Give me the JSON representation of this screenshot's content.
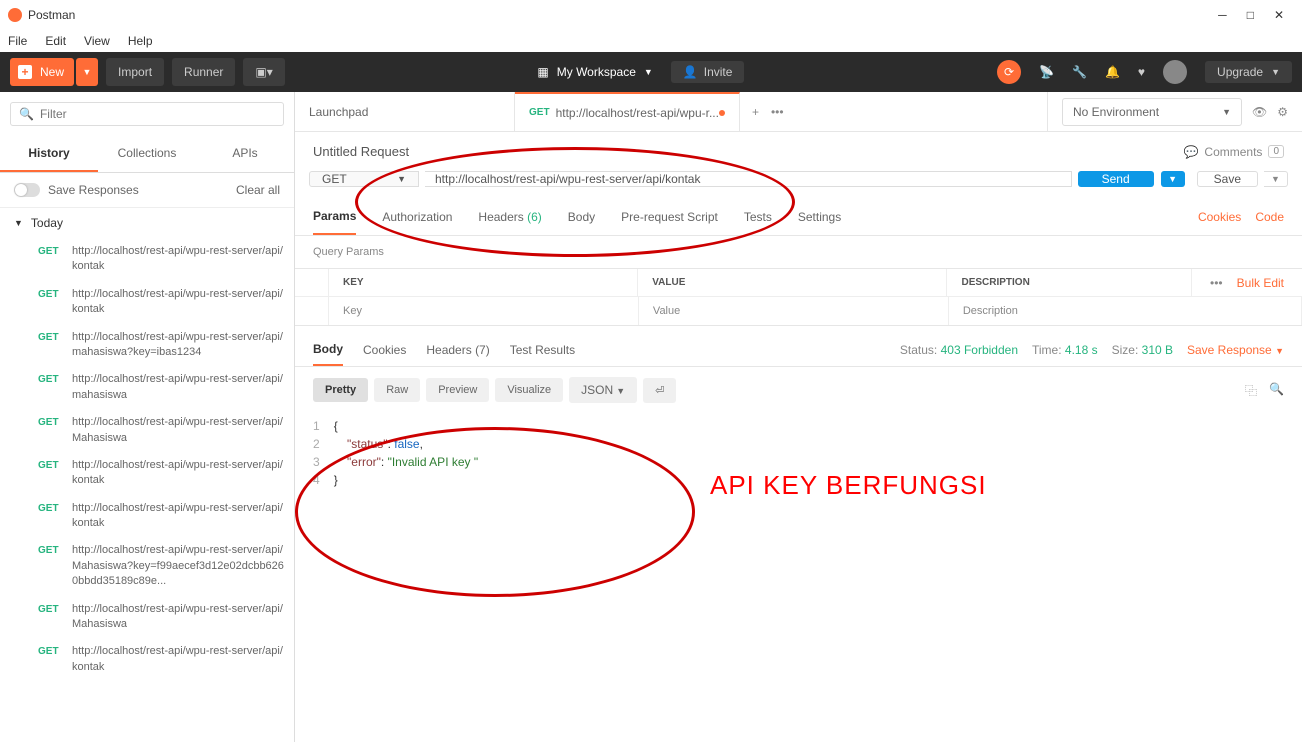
{
  "app": {
    "title": "Postman"
  },
  "menu": {
    "file": "File",
    "edit": "Edit",
    "view": "View",
    "help": "Help"
  },
  "window": {
    "minimize": "─",
    "maximize": "□",
    "close": "✕"
  },
  "toolbar": {
    "new": "New",
    "import": "Import",
    "runner": "Runner",
    "workspace": "My Workspace",
    "invite": "Invite",
    "upgrade": "Upgrade"
  },
  "sidebar": {
    "filter_placeholder": "Filter",
    "tabs": {
      "history": "History",
      "collections": "Collections",
      "apis": "APIs"
    },
    "save_responses": "Save Responses",
    "clear_all": "Clear all",
    "today": "Today",
    "history": [
      {
        "method": "GET",
        "url": "http://localhost/rest-api/wpu-rest-server/api/kontak"
      },
      {
        "method": "GET",
        "url": "http://localhost/rest-api/wpu-rest-server/api/kontak"
      },
      {
        "method": "GET",
        "url": "http://localhost/rest-api/wpu-rest-server/api/mahasiswa?key=ibas1234"
      },
      {
        "method": "GET",
        "url": "http://localhost/rest-api/wpu-rest-server/api/mahasiswa"
      },
      {
        "method": "GET",
        "url": "http://localhost/rest-api/wpu-rest-server/api/Mahasiswa"
      },
      {
        "method": "GET",
        "url": "http://localhost/rest-api/wpu-rest-server/api/kontak"
      },
      {
        "method": "GET",
        "url": "http://localhost/rest-api/wpu-rest-server/api/kontak"
      },
      {
        "method": "GET",
        "url": "http://localhost/rest-api/wpu-rest-server/api/Mahasiswa?key=f99aecef3d12e02dcbb6260bbdd35189c89e..."
      },
      {
        "method": "GET",
        "url": "http://localhost/rest-api/wpu-rest-server/api/Mahasiswa"
      },
      {
        "method": "GET",
        "url": "http://localhost/rest-api/wpu-rest-server/api/kontak"
      }
    ]
  },
  "tabs": {
    "t1": "Launchpad",
    "t2_method": "GET",
    "t2_url": "http://localhost/rest-api/wpu-r..."
  },
  "env": {
    "none": "No Environment"
  },
  "request": {
    "name": "Untitled Request",
    "comments": "Comments",
    "comments_count": "0",
    "method": "GET",
    "url": "http://localhost/rest-api/wpu-rest-server/api/kontak",
    "send": "Send",
    "save": "Save",
    "tabs": {
      "params": "Params",
      "auth": "Authorization",
      "headers": "Headers",
      "headers_count": "(6)",
      "body": "Body",
      "prereq": "Pre-request Script",
      "tests": "Tests",
      "settings": "Settings"
    },
    "cookies": "Cookies",
    "code": "Code",
    "query_params": "Query Params",
    "bulk_edit": "Bulk Edit",
    "th": {
      "key": "KEY",
      "value": "VALUE",
      "desc": "DESCRIPTION"
    },
    "ph": {
      "key": "Key",
      "value": "Value",
      "desc": "Description"
    }
  },
  "response": {
    "tabs": {
      "body": "Body",
      "cookies": "Cookies",
      "headers": "Headers",
      "headers_count": "(7)",
      "tests": "Test Results"
    },
    "status_lbl": "Status:",
    "status": "403 Forbidden",
    "time_lbl": "Time:",
    "time": "4.18 s",
    "size_lbl": "Size:",
    "size": "310 B",
    "save": "Save Response",
    "views": {
      "pretty": "Pretty",
      "raw": "Raw",
      "preview": "Preview",
      "visualize": "Visualize",
      "json": "JSON"
    },
    "body": {
      "l1": "{",
      "l2_key": "\"status\"",
      "l2_val": "false",
      "l2_comma": ",",
      "l3_key": "\"error\"",
      "l3_val": "\"Invalid API key \"",
      "l4": "}"
    }
  },
  "annotation": "API KEY BERFUNGSI"
}
